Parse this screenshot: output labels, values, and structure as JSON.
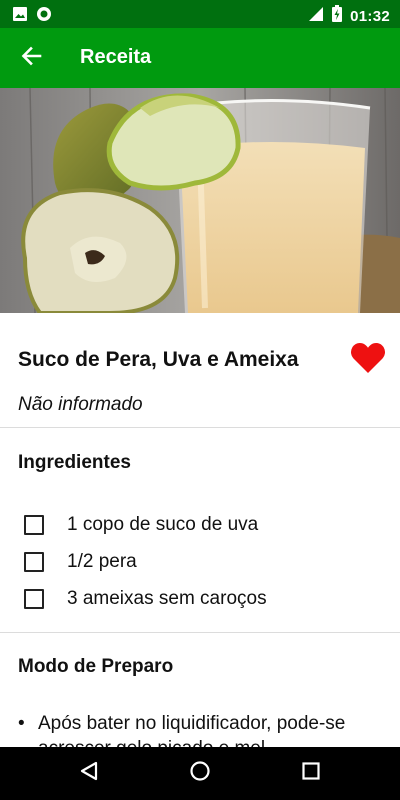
{
  "status_bar": {
    "time": "01:32",
    "icons": [
      "image-icon",
      "circle-notification-icon",
      "signal-icon",
      "battery-charging-icon"
    ]
  },
  "app_bar": {
    "title": "Receita",
    "back_icon": "arrow-back-icon",
    "background": "#009a0f",
    "status_background": "#00700f"
  },
  "recipe": {
    "title": "Suco de Pera, Uva e Ameixa",
    "subtitle": "Não informado",
    "favorite_icon": "heart-icon",
    "favorite_color": "#ee1111",
    "favorited": true
  },
  "ingredients": {
    "heading": "Ingredientes",
    "items": [
      {
        "label": "1 copo de suco de uva",
        "checked": false
      },
      {
        "label": "1/2 pera",
        "checked": false
      },
      {
        "label": "3 ameixas sem caroços",
        "checked": false
      }
    ]
  },
  "preparation": {
    "heading": "Modo de Preparo",
    "steps": [
      "Após bater no liquidificador, pode-se acrescer gelo picado e mel."
    ]
  },
  "nav_bar": {
    "icons": [
      "back-triangle-icon",
      "home-circle-icon",
      "recents-square-icon"
    ]
  }
}
